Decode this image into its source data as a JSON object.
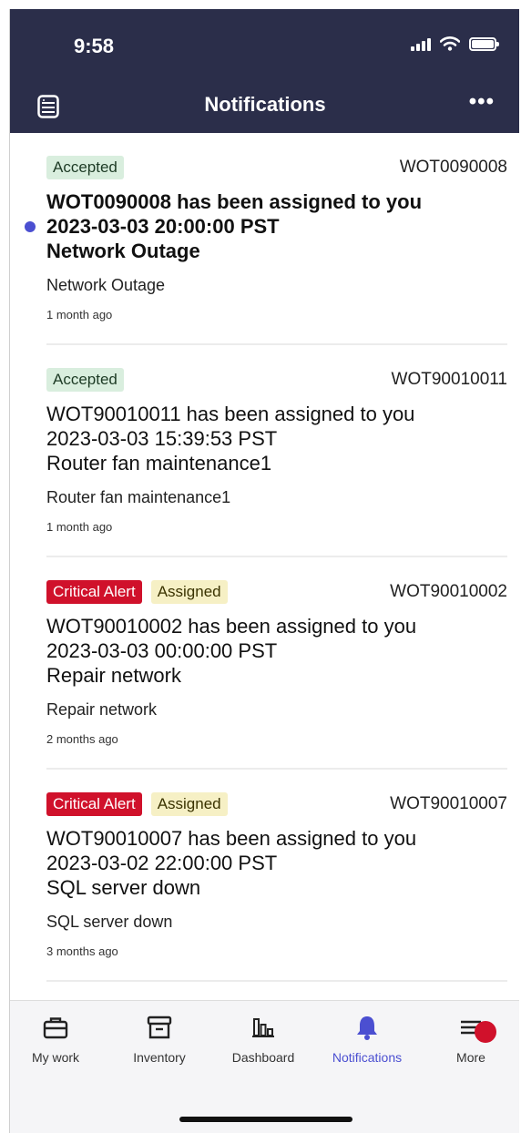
{
  "status_bar": {
    "time": "9:58"
  },
  "header": {
    "title": "Notifications",
    "more_label": "•••"
  },
  "notifications": [
    {
      "tags": [
        "Accepted"
      ],
      "id": "WOT0090008",
      "title_line1": "WOT0090008 has been assigned to you",
      "title_line2": "2023-03-03 20:00:00 PST",
      "title_line3": "Network Outage",
      "subject": "Network Outage",
      "age": "1 month ago",
      "unread": true
    },
    {
      "tags": [
        "Accepted"
      ],
      "id": "WOT90010011",
      "title_line1": "WOT90010011 has been assigned to you",
      "title_line2": "2023-03-03 15:39:53 PST",
      "title_line3": "Router fan maintenance1",
      "subject": "Router fan maintenance1",
      "age": "1 month ago",
      "unread": false
    },
    {
      "tags": [
        "Critical Alert",
        "Assigned"
      ],
      "id": "WOT90010002",
      "title_line1": "WOT90010002 has been assigned to you",
      "title_line2": "2023-03-03 00:00:00 PST",
      "title_line3": "Repair network",
      "subject": "Repair network",
      "age": "2 months ago",
      "unread": false
    },
    {
      "tags": [
        "Critical Alert",
        "Assigned"
      ],
      "id": "WOT90010007",
      "title_line1": "WOT90010007 has been assigned to you",
      "title_line2": "2023-03-02 22:00:00 PST",
      "title_line3": "SQL server down",
      "subject": "SQL server down",
      "age": "3 months ago",
      "unread": false
    }
  ],
  "tabbar": {
    "tabs": [
      {
        "label": "My work",
        "icon": "briefcase-icon"
      },
      {
        "label": "Inventory",
        "icon": "archive-box-icon"
      },
      {
        "label": "Dashboard",
        "icon": "bar-chart-icon"
      },
      {
        "label": "Notifications",
        "icon": "bell-icon",
        "active": true
      },
      {
        "label": "More",
        "icon": "menu-icon"
      }
    ]
  },
  "colors": {
    "header_bg": "#2b2e4a",
    "accent": "#4b4fd1",
    "critical": "#d0112b",
    "accepted_bg": "#d9eede",
    "assigned_bg": "#f6f0c5"
  }
}
